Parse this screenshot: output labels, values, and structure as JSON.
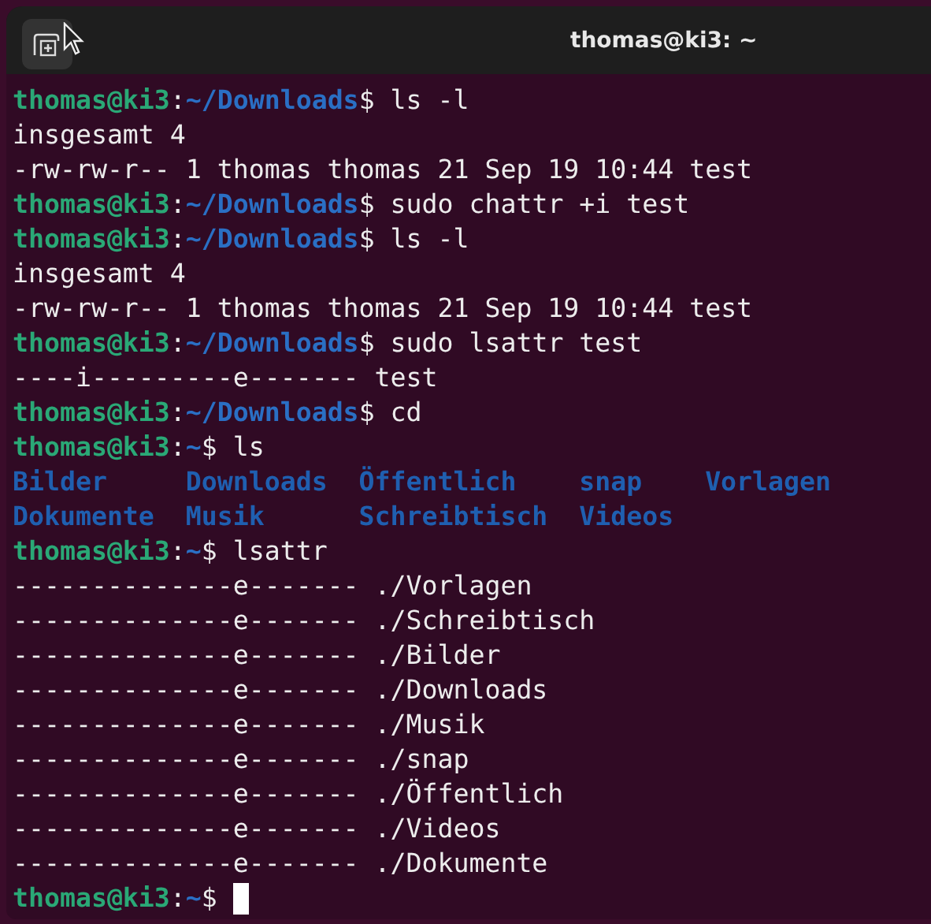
{
  "window": {
    "title": "thomas@ki3: ~"
  },
  "lines": [
    {
      "kind": "prompt",
      "user": "thomas@ki3",
      "sep": ":",
      "path": "~/Downloads",
      "symbol": "$",
      "command": "ls -l"
    },
    {
      "kind": "output",
      "text": "insgesamt 4"
    },
    {
      "kind": "output",
      "text": "-rw-rw-r-- 1 thomas thomas 21 Sep 19 10:44 test"
    },
    {
      "kind": "prompt",
      "user": "thomas@ki3",
      "sep": ":",
      "path": "~/Downloads",
      "symbol": "$",
      "command": "sudo chattr +i test"
    },
    {
      "kind": "prompt",
      "user": "thomas@ki3",
      "sep": ":",
      "path": "~/Downloads",
      "symbol": "$",
      "command": "ls -l"
    },
    {
      "kind": "output",
      "text": "insgesamt 4"
    },
    {
      "kind": "output",
      "text": "-rw-rw-r-- 1 thomas thomas 21 Sep 19 10:44 test"
    },
    {
      "kind": "prompt",
      "user": "thomas@ki3",
      "sep": ":",
      "path": "~/Downloads",
      "symbol": "$",
      "command": "sudo lsattr test"
    },
    {
      "kind": "output",
      "text": "----i---------e------- test"
    },
    {
      "kind": "prompt",
      "user": "thomas@ki3",
      "sep": ":",
      "path": "~/Downloads",
      "symbol": "$",
      "command": "cd"
    },
    {
      "kind": "prompt",
      "user": "thomas@ki3",
      "sep": ":",
      "path": "~",
      "symbol": "$",
      "command": "ls"
    },
    {
      "kind": "dirs",
      "items": [
        "Bilder",
        "Downloads",
        "Öffentlich",
        "snap",
        "Vorlagen",
        "Dokumente",
        "Musik",
        "Schreibtisch",
        "Videos"
      ]
    },
    {
      "kind": "prompt",
      "user": "thomas@ki3",
      "sep": ":",
      "path": "~",
      "symbol": "$",
      "command": "lsattr"
    },
    {
      "kind": "output",
      "text": "--------------e------- ./Vorlagen"
    },
    {
      "kind": "output",
      "text": "--------------e------- ./Schreibtisch"
    },
    {
      "kind": "output",
      "text": "--------------e------- ./Bilder"
    },
    {
      "kind": "output",
      "text": "--------------e------- ./Downloads"
    },
    {
      "kind": "output",
      "text": "--------------e------- ./Musik"
    },
    {
      "kind": "output",
      "text": "--------------e------- ./snap"
    },
    {
      "kind": "output",
      "text": "--------------e------- ./Öffentlich"
    },
    {
      "kind": "output",
      "text": "--------------e------- ./Videos"
    },
    {
      "kind": "output",
      "text": "--------------e------- ./Dokumente"
    },
    {
      "kind": "prompt",
      "user": "thomas@ki3",
      "sep": ":",
      "path": "~",
      "symbol": "$",
      "cursor": true
    }
  ]
}
